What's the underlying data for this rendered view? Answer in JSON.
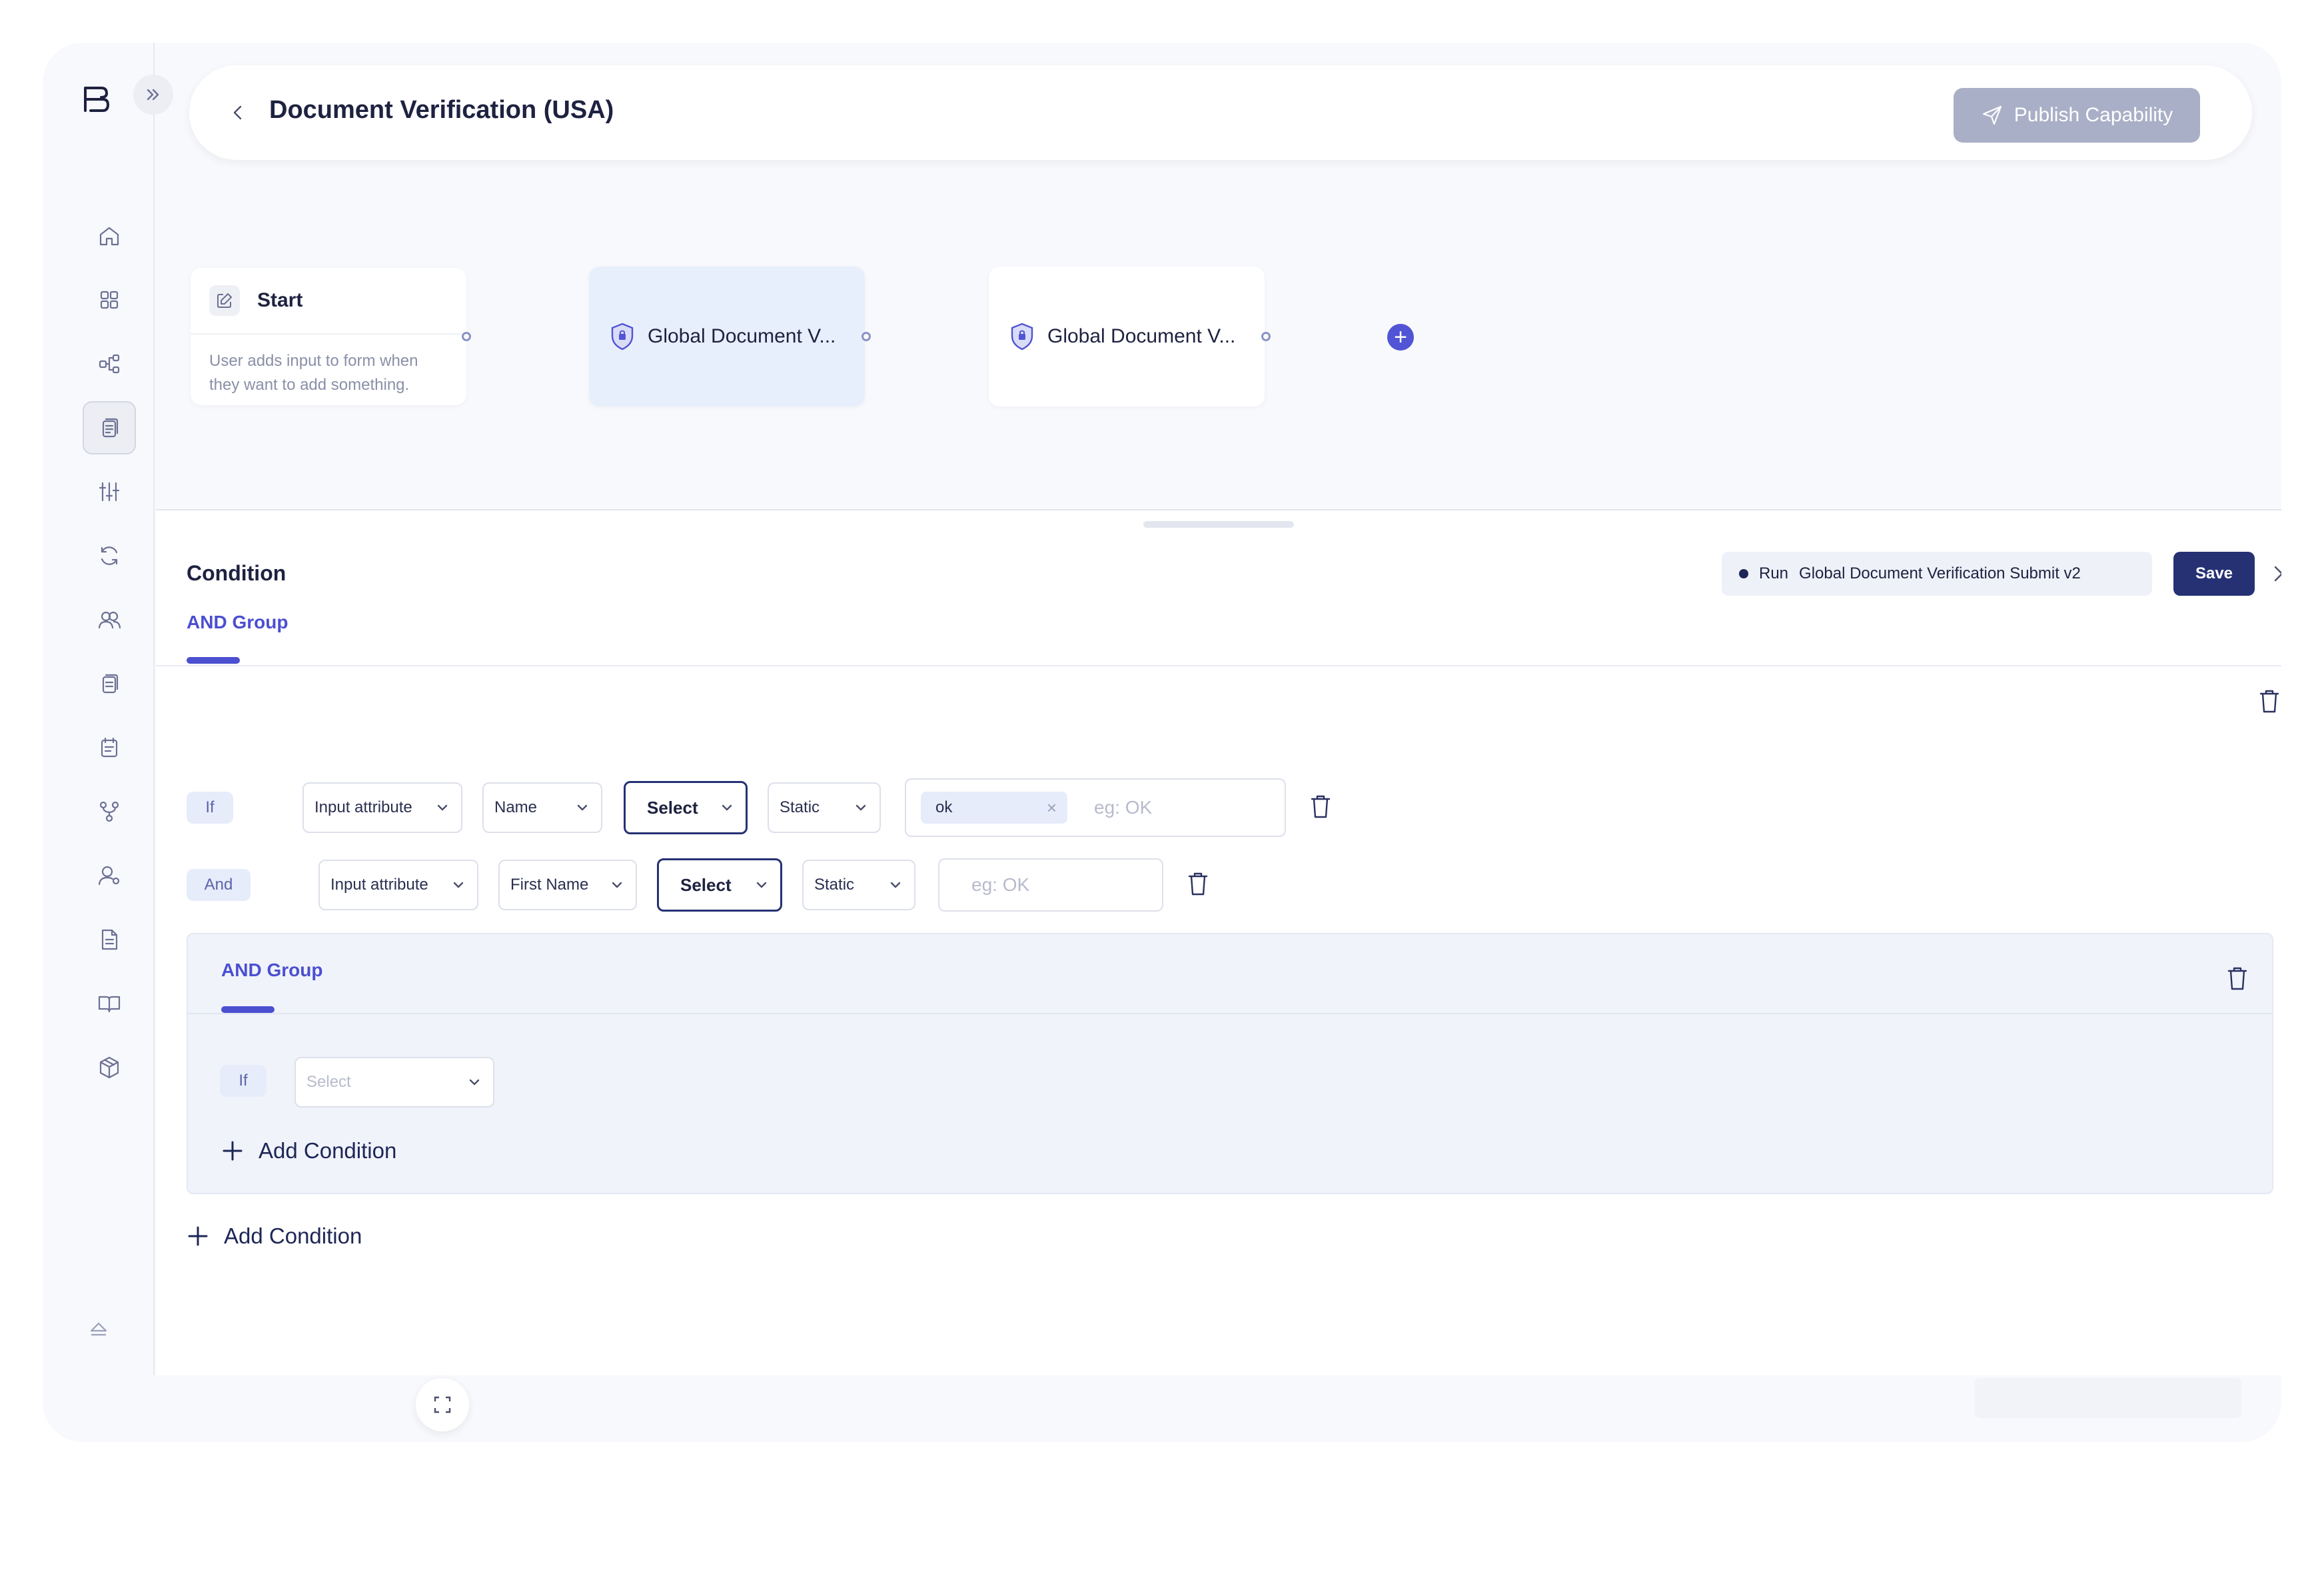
{
  "header": {
    "title": "Document Verification (USA)",
    "publish_label": "Publish Capability"
  },
  "flow": {
    "start": {
      "title": "Start",
      "description": "User adds input to form when they want to add something."
    },
    "nodes": [
      {
        "label": "Global Document V..."
      },
      {
        "label": "Global Document V..."
      }
    ]
  },
  "panel": {
    "title": "Condition",
    "run_label": "Run",
    "run_target": "Global Document Verification Submit v2",
    "save_label": "Save",
    "group_label": "AND Group",
    "rows": [
      {
        "connector": "If",
        "source": "Input attribute",
        "attribute": "Name",
        "operator": "Select",
        "value_type": "Static",
        "tag": "ok",
        "value_placeholder": "eg: OK"
      },
      {
        "connector": "And",
        "source": "Input attribute",
        "attribute": "First Name",
        "operator": "Select",
        "value_type": "Static",
        "value_placeholder": "eg: OK"
      }
    ],
    "subgroup": {
      "label": "AND Group",
      "row": {
        "connector": "If",
        "select_placeholder": "Select"
      },
      "add_condition_label": "Add Condition"
    },
    "add_condition_label": "Add Condition"
  },
  "colors": {
    "accent": "#4b4fd0",
    "primary_dark": "#263174",
    "publish_disabled": "#a9afc6"
  },
  "icons": [
    "logo-icon",
    "home-icon",
    "grid-icon",
    "workflow-icon",
    "documents-icon",
    "sliders-icon",
    "refresh-icon",
    "users-icon",
    "files-icon",
    "calendar-icon",
    "branch-icon",
    "user-settings-icon",
    "report-icon",
    "book-icon",
    "package-icon",
    "eject-icon",
    "shield-icon",
    "trash-icon",
    "close-icon",
    "send-icon"
  ]
}
